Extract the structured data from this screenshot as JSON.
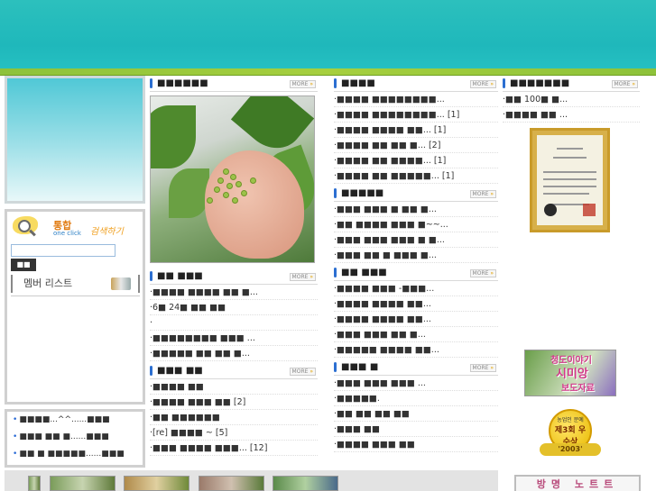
{
  "left": {
    "search_logo_big": "통합",
    "search_logo_small": "one click",
    "search_logo_right": "검색하기",
    "search_button": "■■",
    "member_list": "멤버 리스트",
    "recent": [
      "■■■■...^^......■■■",
      "■■■ ■■ ■......■■■",
      "■■ ■ ■■■■■......■■■"
    ]
  },
  "col1": {
    "photo_section_title": "■■■■■■",
    "section2": {
      "title": "■■ ■■■",
      "items": [
        "■■■■ ■■■■ ■■ ■...",
        "6■ 24■ ■■ ■■",
        "",
        "■■■■■■■■ ■■■ ...",
        "■■■■■ ■■ ■■ ■..."
      ]
    },
    "section3": {
      "title": "■■■ ■■",
      "items": [
        "■■■■ ■■",
        "■■■■ ■■■ ■■ [2]",
        "■■ ■■■■■■",
        "[re] ■■■■ ~ [5]",
        "■■■ ■■■■ ■■■... [12]"
      ]
    }
  },
  "col2": {
    "section1": {
      "title": "■■■■",
      "items": [
        "■■■■ ■■■■■■■■...",
        "■■■■ ■■■■■■■■... [1]",
        "■■■■ ■■■■ ■■... [1]",
        "■■■■ ■■ ■■ ■... [2]",
        "■■■■ ■■ ■■■■... [1]",
        "■■■■ ■■ ■■■■■... [1]"
      ]
    },
    "section2": {
      "title": "■■■■■",
      "items": [
        "■■■ ■■■ ■ ■■ ■...",
        "■■ ■■■■ ■■■ ■~~...",
        "■■■ ■■■ ■■■ ■ ■...",
        "■■■ ■■ ■ ■■■ ■..."
      ]
    },
    "section3": {
      "title": "■■ ■■■",
      "items": [
        "■■■■ ■■■ -■■■...",
        "■■■■ ■■■■ ■■...",
        "■■■■ ■■■■ ■■...",
        "■■■ ■■■ ■■ ■...",
        "■■■■■ ■■■■ ■■..."
      ]
    },
    "section4": {
      "title": "■■■ ■",
      "items": [
        "■■■ ■■■ ■■■ ...",
        "■■■■■.",
        "■■ ■■ ■■ ■■",
        "■■■ ■■",
        "■■■■ ■■■ ■■"
      ]
    }
  },
  "col3": {
    "title": "■■■■■■■",
    "items": [
      "■■ 100■ ■...",
      "■■■■ ■■ ..."
    ]
  },
  "banner": {
    "line1": "청도이야기",
    "line2": "시미앙",
    "line3": "보도자료"
  },
  "medal": {
    "top": "농업인 문예",
    "main": "제3회 우수상",
    "year": "'2003'"
  },
  "guestbook": "방명 노트트",
  "more_label": "MORE",
  "colors": {
    "header": "#1fb8bb",
    "stripe": "#8dc23a",
    "bullet": "#2c6fd1"
  }
}
